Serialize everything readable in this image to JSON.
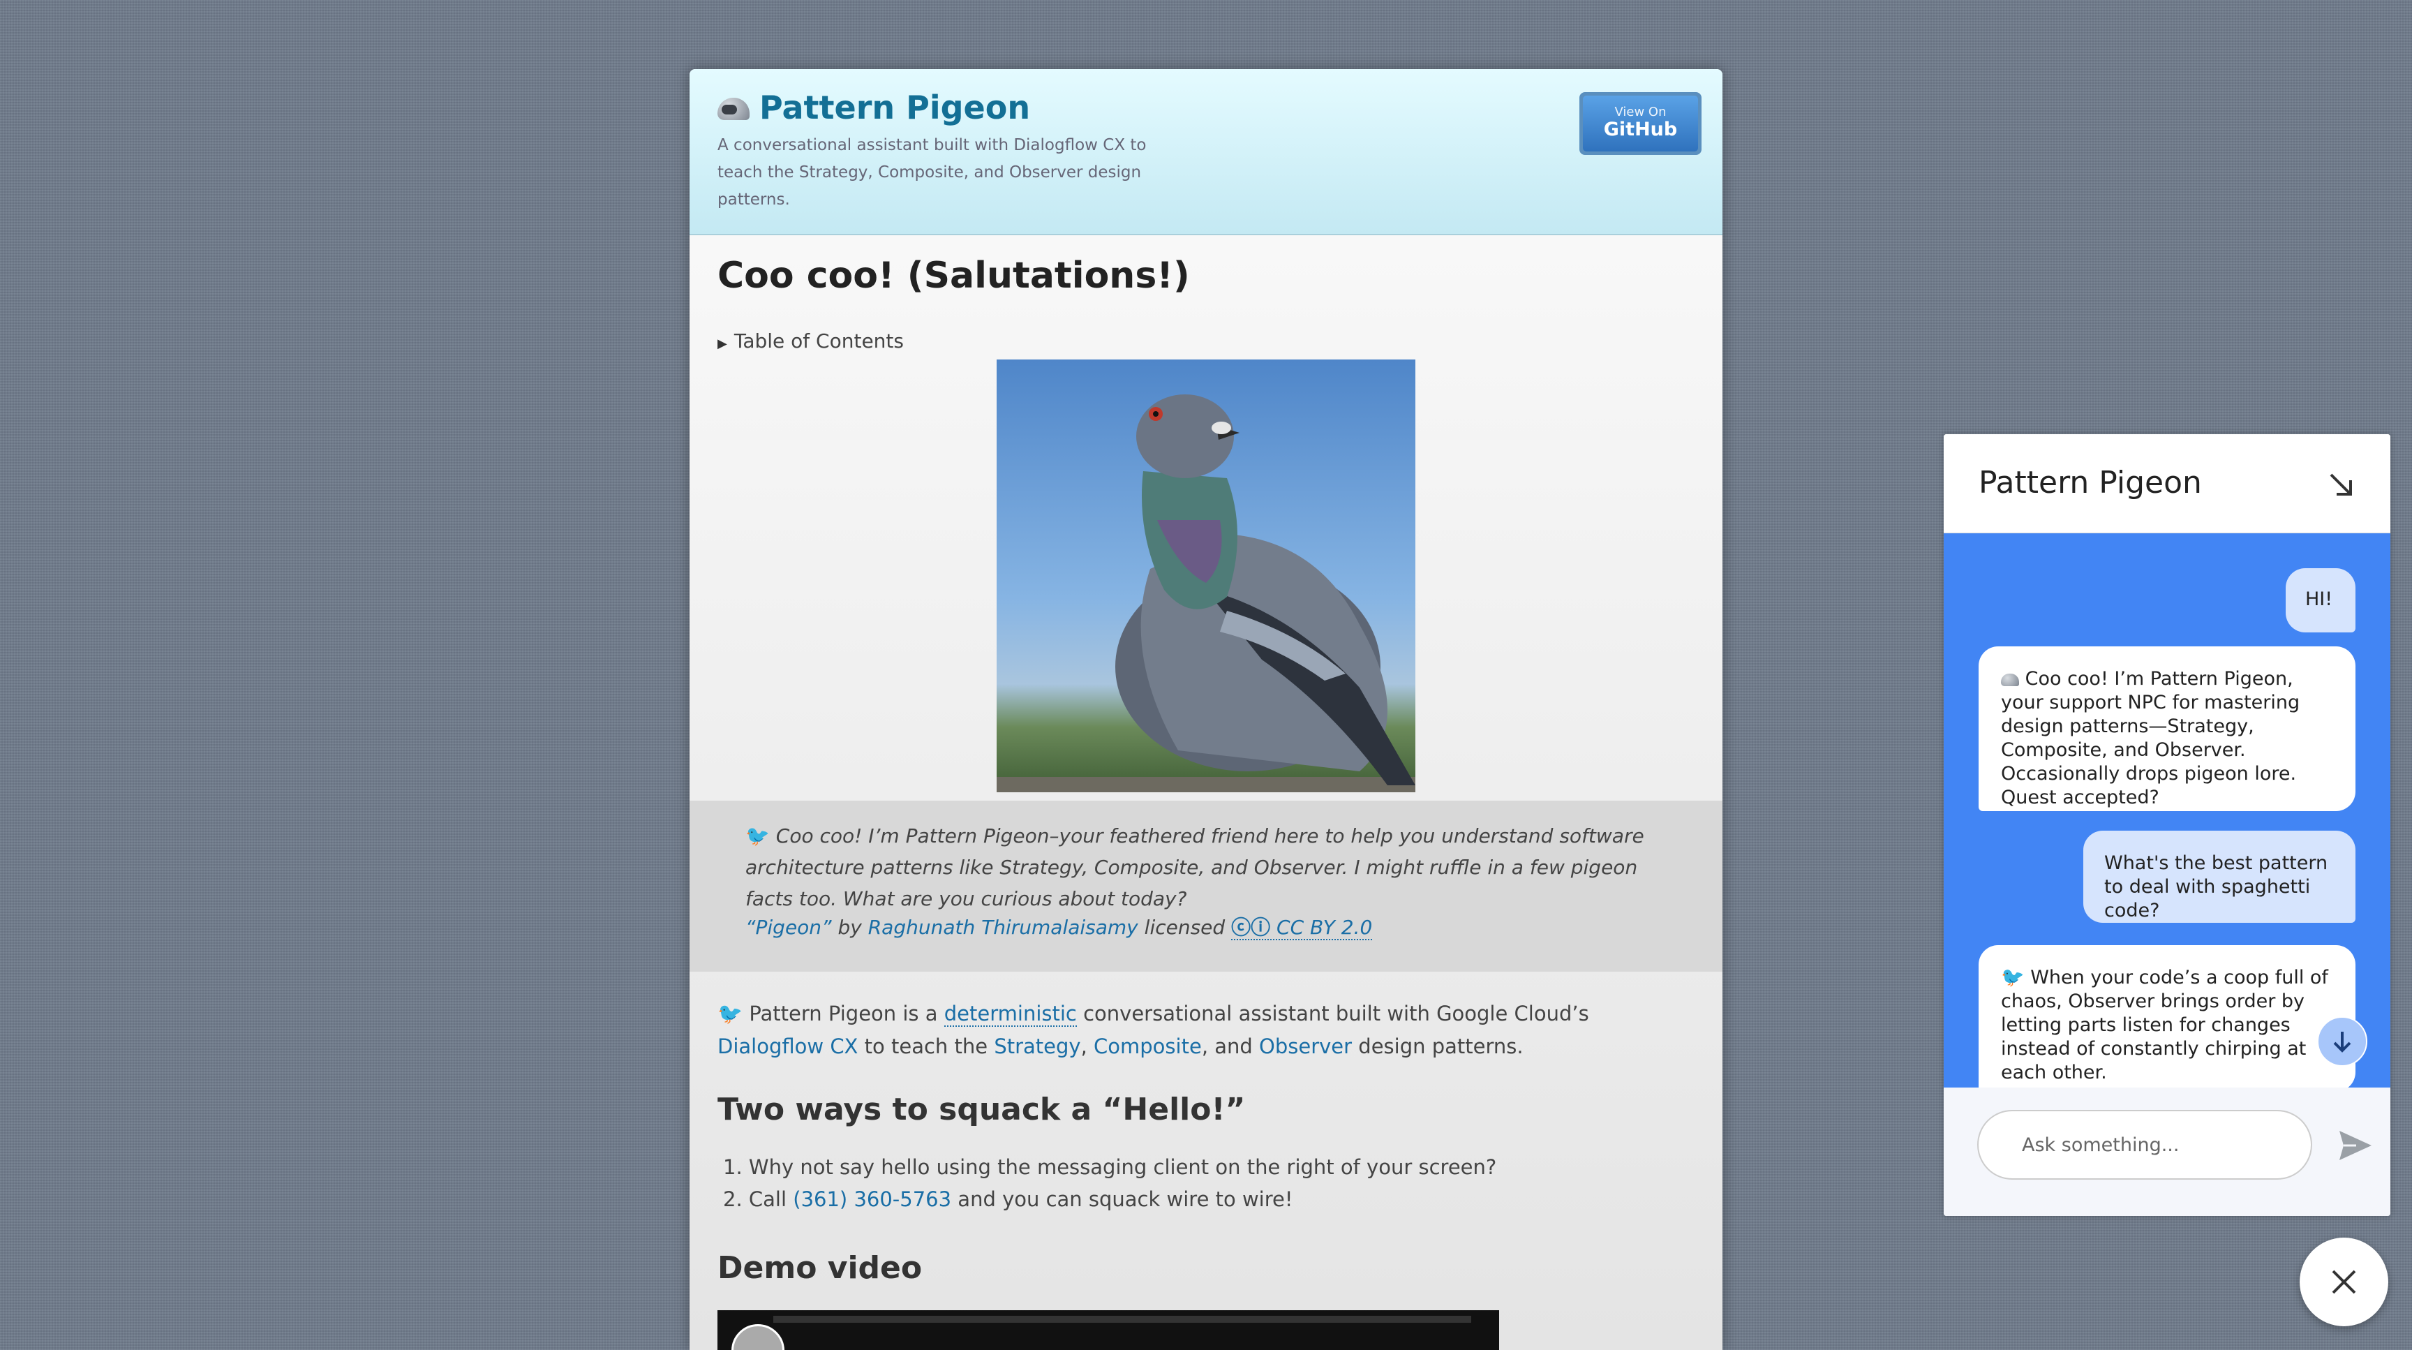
{
  "header": {
    "title": "Pattern Pigeon",
    "description": "A conversational assistant built with Dialogflow CX to teach the Strategy, Composite, and Observer design patterns.",
    "github_small": "View On",
    "github_big": "GitHub"
  },
  "main": {
    "heading": "Coo coo! (Salutations!)",
    "toc_label": "Table of Contents",
    "quote": {
      "icon": "bird-icon",
      "text": "Coo coo! I’m Pattern Pigeon–your feathered friend here to help you understand software architecture patterns like Strategy, Composite, and Observer. I might ruffle in a few pigeon facts too. What are you curious about today?",
      "credit_title": "“Pigeon”",
      "credit_by": "by",
      "credit_author": "Raghunath Thirumalaisamy",
      "credit_licensed": "licensed",
      "credit_license": "CC BY 2.0",
      "cc_icons": "cc-by-icon"
    },
    "intro": {
      "before": "Pattern Pigeon is a",
      "deterministic": "deterministic",
      "middle": "conversational assistant built with Google Cloud’s",
      "dialogflow": "Dialogflow CX",
      "to_teach": "to teach the",
      "strategy": "Strategy",
      "comma": ",",
      "composite": "Composite",
      "and": ", and",
      "observer": "Observer",
      "after": "design patterns."
    },
    "h2_hello": "Two ways to squack a “Hello!”",
    "list": {
      "item1": "Why not say hello using the messaging client on the right of your screen?",
      "item2_before": "Call",
      "item2_phone": "(361) 360-5763",
      "item2_after": "and you can squack wire to wire!",
      "num1": "1.",
      "num2": "2."
    },
    "h2_demo": "Demo video"
  },
  "chat": {
    "title": "Pattern Pigeon",
    "messages": [
      {
        "role": "user",
        "text": "HI!"
      },
      {
        "role": "bot",
        "icon": "helmet-icon",
        "text": "Coo coo! I’m Pattern Pigeon, your support NPC for mastering design patterns—Strategy, Composite, and Observer. Occasionally drops pigeon lore. Quest accepted?"
      },
      {
        "role": "user",
        "text": "What's the best pattern to deal with spaghetti code?"
      },
      {
        "role": "bot",
        "icon": "bird-icon",
        "text": "When your code’s a coop full of chaos, Observer brings order by letting parts listen for changes instead of constantly chirping at each other."
      }
    ],
    "input_placeholder": "Ask something..."
  },
  "colors": {
    "link": "#1a6ea6",
    "title": "#136f95",
    "chat_bg": "#4285f4",
    "user_bubble": "#d6e4fd"
  }
}
